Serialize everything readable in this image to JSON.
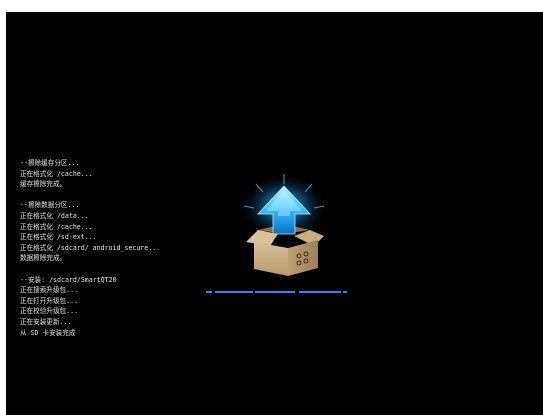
{
  "log": {
    "group1": [
      "--擦除缓存分区...",
      "正在格式化 /cache...",
      "缓存擦除完成。"
    ],
    "group2": [
      "--擦除数据分区...",
      "正在格式化 /data...",
      "正在格式化 /cache...",
      "正在格式化 /sd-ext...",
      "正在格式化 /sdcard/ android_secure...",
      "数据擦除完成。"
    ],
    "group3": [
      "--安装: /sdcard/SmartQT20",
      "正在搜索升级包...",
      "正在打开升级包...",
      "正在校验升级包...",
      "正在安装更新...",
      "从 SD 卡安装完成"
    ]
  },
  "icons": {
    "installer": "box-with-upload-arrow-icon"
  },
  "colors": {
    "background": "#000000",
    "text": "#e6e6e6",
    "progress": "#2f7fff",
    "arrow": "#26b8ff",
    "box": "#c9ae84"
  }
}
